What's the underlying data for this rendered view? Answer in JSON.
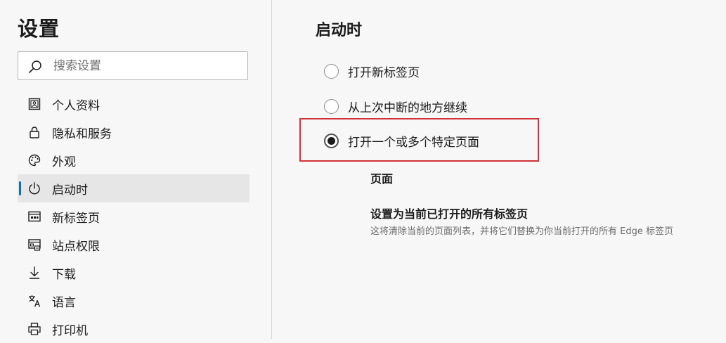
{
  "sidebar": {
    "title": "设置",
    "search": {
      "placeholder": "搜索设置",
      "value": ""
    },
    "items": [
      {
        "label": "个人资料",
        "icon": "profile-icon",
        "active": false
      },
      {
        "label": "隐私和服务",
        "icon": "lock-icon",
        "active": false
      },
      {
        "label": "外观",
        "icon": "palette-icon",
        "active": false
      },
      {
        "label": "启动时",
        "icon": "power-icon",
        "active": true
      },
      {
        "label": "新标签页",
        "icon": "new-tab-icon",
        "active": false
      },
      {
        "label": "站点权限",
        "icon": "site-permissions-icon",
        "active": false
      },
      {
        "label": "下载",
        "icon": "download-icon",
        "active": false
      },
      {
        "label": "语言",
        "icon": "language-icon",
        "active": false
      },
      {
        "label": "打印机",
        "icon": "printer-icon",
        "active": false
      }
    ]
  },
  "main": {
    "section_title": "启动时",
    "options": [
      {
        "label": "打开新标签页",
        "checked": false
      },
      {
        "label": "从上次中断的地方继续",
        "checked": false
      },
      {
        "label": "打开一个或多个特定页面",
        "checked": true
      }
    ],
    "pages_label": "页面",
    "set_current": {
      "title": "设置为当前已打开的所有标签页",
      "description": "这将清除当前的页面列表，并将它们替换为你当前打开的所有 Edge 标签页"
    }
  },
  "colors": {
    "accent": "#0f6cbd",
    "highlight": "#d13438",
    "active_bg": "#e6e6e6"
  }
}
